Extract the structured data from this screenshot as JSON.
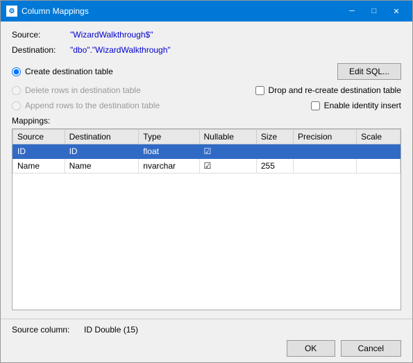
{
  "window": {
    "title": "Column Mappings",
    "icon": "⚙",
    "minimize_label": "─",
    "maximize_label": "□",
    "close_label": "✕"
  },
  "source": {
    "label": "Source:",
    "value": "\"WizardWalkthrough$\""
  },
  "destination": {
    "label": "Destination:",
    "value": "\"dbo\".\"WizardWalkthrough\""
  },
  "options": {
    "create_table": {
      "label": "Create destination table",
      "checked": true,
      "edit_sql_label": "Edit SQL..."
    },
    "delete_rows": {
      "label": "Delete rows in destination table",
      "checked": false,
      "disabled": true
    },
    "append_rows": {
      "label": "Append rows to the destination table",
      "checked": false,
      "disabled": true
    },
    "drop_recreate": {
      "label": "Drop and re-create destination table",
      "checked": false,
      "disabled": false
    },
    "enable_identity": {
      "label": "Enable identity insert",
      "checked": false,
      "disabled": false
    }
  },
  "mappings": {
    "label": "Mappings:",
    "columns": [
      "Source",
      "Destination",
      "Type",
      "Nullable",
      "Size",
      "Precision",
      "Scale"
    ],
    "rows": [
      {
        "source": "ID",
        "destination": "ID",
        "type": "float",
        "nullable": true,
        "size": "",
        "precision": "",
        "scale": "",
        "selected": true
      },
      {
        "source": "Name",
        "destination": "Name",
        "type": "nvarchar",
        "nullable": true,
        "size": "255",
        "precision": "",
        "scale": "",
        "selected": false
      }
    ]
  },
  "source_column": {
    "label": "Source column:",
    "value": "ID Double (15)"
  },
  "buttons": {
    "ok_label": "OK",
    "cancel_label": "Cancel"
  }
}
